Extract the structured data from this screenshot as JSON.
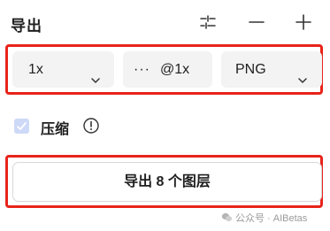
{
  "panel": {
    "title": "导出"
  },
  "header_icons": [
    "sliders-icon",
    "minus-icon",
    "plus-icon"
  ],
  "export_row": {
    "scale": {
      "value": "1x"
    },
    "suffix": {
      "menu_glyph": "···",
      "value": "@1x"
    },
    "format": {
      "value": "PNG"
    }
  },
  "compress": {
    "label": "压缩",
    "checked": true
  },
  "export_button": {
    "label": "导出 8 个图层"
  },
  "watermark": {
    "text": "公众号 · AIBetas"
  },
  "colors": {
    "highlight": "#e8231a",
    "checkbox_fill": "#cdd9f7",
    "field_bg": "#f3f3f3"
  }
}
